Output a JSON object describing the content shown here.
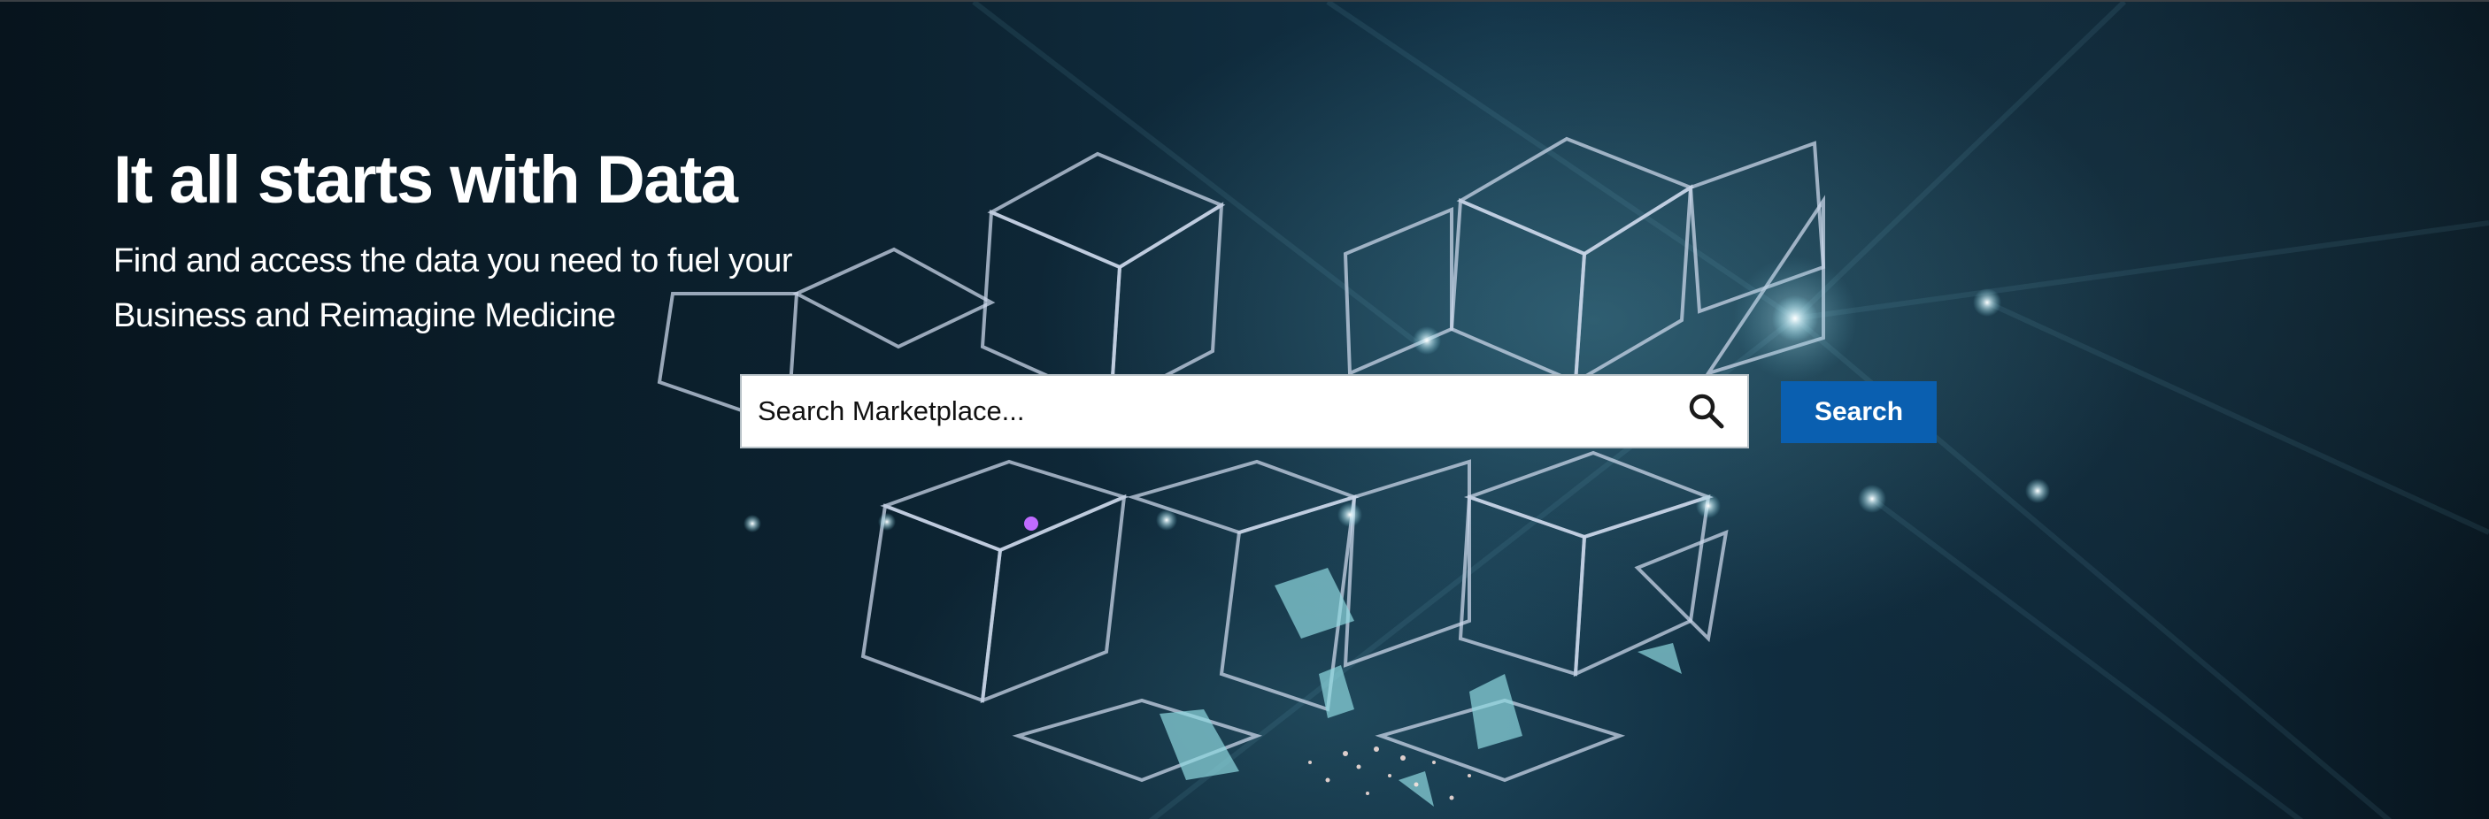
{
  "hero": {
    "headline": "It all starts with Data",
    "subheadline_line1": "Find and access the data you need to fuel your",
    "subheadline_line2": "Business and Reimagine Medicine",
    "background_image": "glowing-wireframe-cubes"
  },
  "search": {
    "placeholder": "Search Marketplace...",
    "value": "",
    "icon": "search-icon",
    "button_label": "Search"
  },
  "colors": {
    "headline_text": "#ffffff",
    "button_background": "#0a5fb0",
    "button_text": "#ffffff",
    "input_background": "#ffffff",
    "hero_background": "#0c2230"
  }
}
